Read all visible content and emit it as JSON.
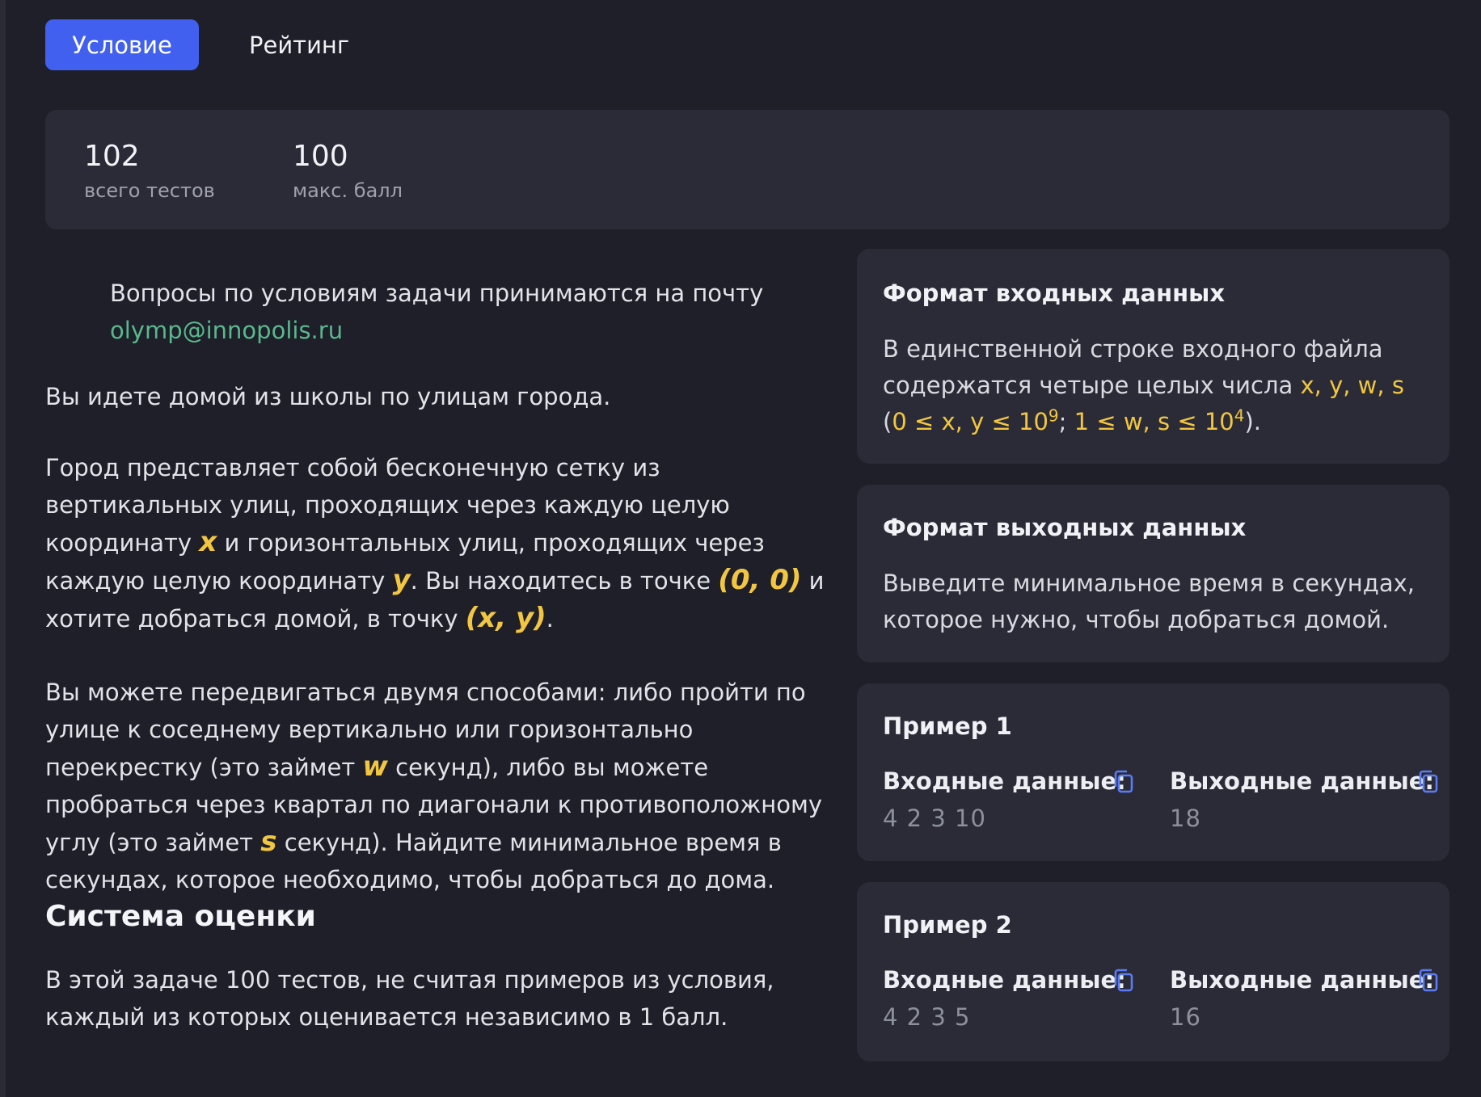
{
  "tabs": [
    {
      "label": "Условие",
      "active": true
    },
    {
      "label": "Рейтинг",
      "active": false
    }
  ],
  "stats": {
    "tests_count": "102",
    "tests_label": "всего тестов",
    "max_score": "100",
    "max_score_label": "макс. балл"
  },
  "statement": {
    "note_text": "Вопросы по условиям задачи принимаются на почту",
    "note_email": "olymp@innopolis.ru",
    "intro": "Вы идете домой из школы по улицам города.",
    "p2": {
      "t1": "Город представляет собой бесконечную сетку из вертикальных улиц, проходящих через каждую целую координату ",
      "x": "x",
      "t2": " и горизонтальных улиц, проходящих через каждую целую координату ",
      "y": "y",
      "t3": ". Вы находитесь в точке ",
      "start": "(0, 0)",
      "t4": " и хотите добраться домой, в точку ",
      "home": "(x, y)",
      "t5": "."
    },
    "p3": {
      "t1": "Вы можете передвигаться двумя способами: либо пройти по улице к соседнему вертикально или горизонтально перекрестку (это займет ",
      "w": "w",
      "t2": " секунд), либо вы можете пробраться через квартал по диагонали к противоположному углу (это займет ",
      "s": "s",
      "t3": " секунд). Найдите минимальное время в секундах, которое необходимо, чтобы добраться до дома."
    },
    "scoring_title": "Система оценки",
    "scoring_text": "В этой задаче 100 тестов, не считая примеров из условия, каждый из которых оценивается независимо в 1 балл."
  },
  "input_format": {
    "title": "Формат входных данных",
    "t1": "В единственной строке входного файла содержатся четыре целых числа ",
    "vars": "x, y, w, s",
    "t2": " (",
    "c1": "0 ≤ x, y ≤ 10",
    "c1_exp": "9",
    "sep": "; ",
    "c2": "1 ≤ w, s ≤ 10",
    "c2_exp": "4",
    "t3": ")."
  },
  "output_format": {
    "title": "Формат выходных данных",
    "text": "Выведите минимальное время в секундах, которое нужно, чтобы добраться домой."
  },
  "examples": [
    {
      "title": "Пример 1",
      "input_label": "Входные данные:",
      "output_label": "Выходные данные:",
      "input": "4 2 3 10",
      "output": "18"
    },
    {
      "title": "Пример 2",
      "input_label": "Входные данные:",
      "output_label": "Выходные данные:",
      "input": "4 2 3 5",
      "output": "16"
    }
  ],
  "colors": {
    "accent": "#4160f0",
    "highlight": "#f2c640",
    "link": "#59b88e"
  },
  "icons": {
    "copy": "copy-icon"
  }
}
